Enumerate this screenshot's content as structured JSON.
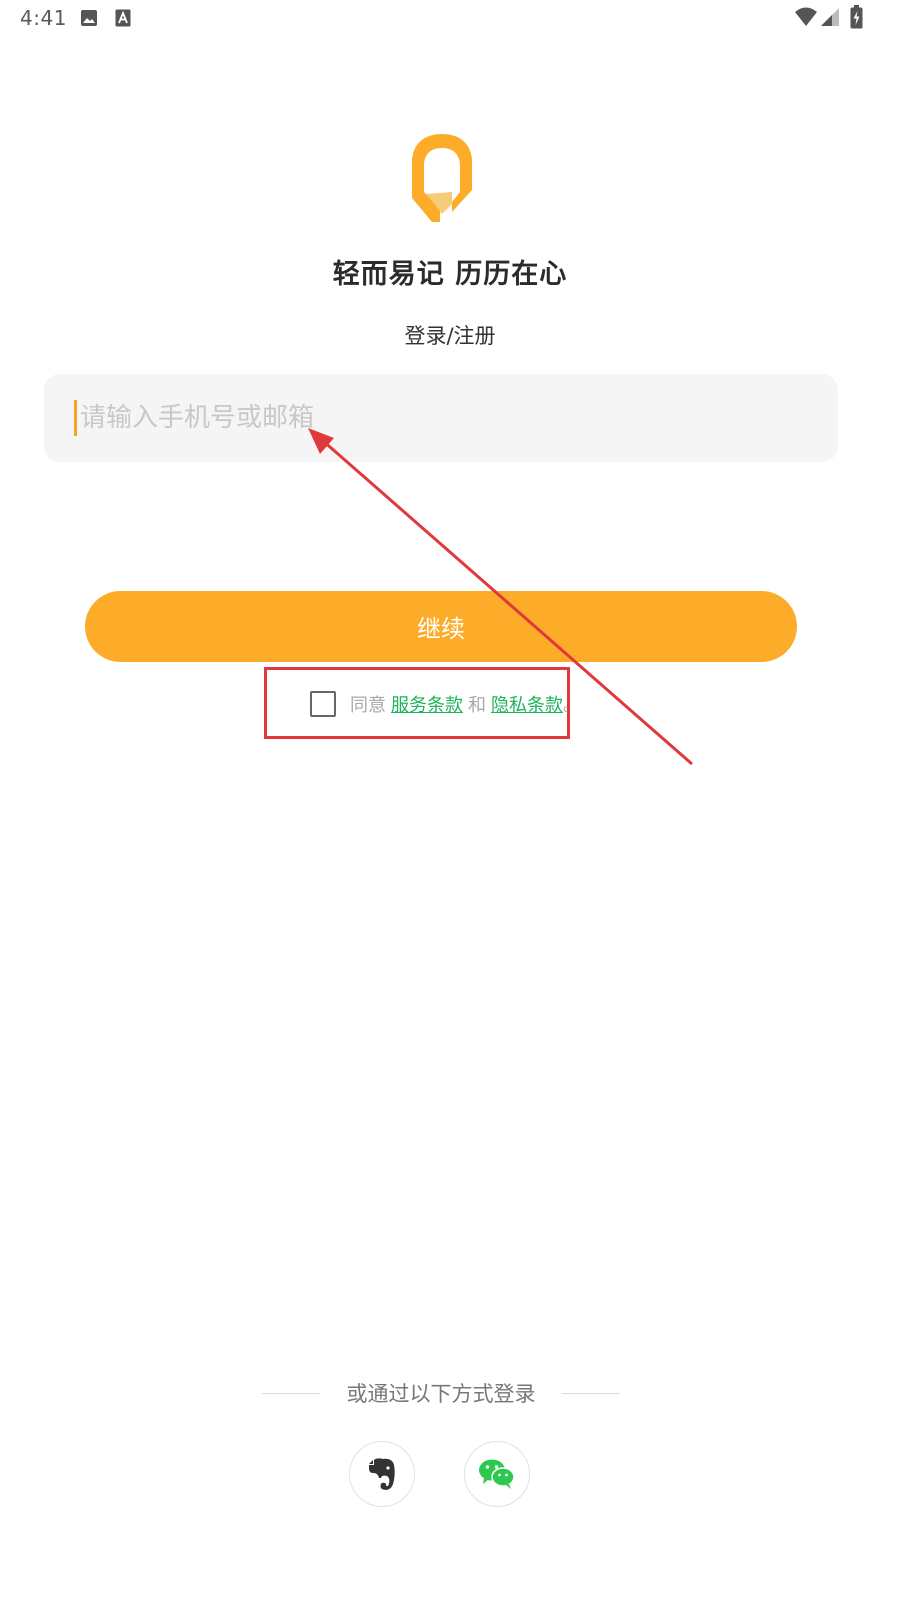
{
  "status_bar": {
    "time": "4:41"
  },
  "brand": {
    "slogan": "轻而易记 历历在心",
    "accent_color": "#fdac2a"
  },
  "login": {
    "title": "登录/注册",
    "input_placeholder": "请输入手机号或邮箱",
    "continue_label": "继续"
  },
  "agreement": {
    "prefix": "同意",
    "terms_link": "服务条款",
    "conjunction": "和",
    "privacy_link": "隐私条款",
    "suffix": "。",
    "checked": false,
    "link_color": "#1fb35a"
  },
  "alt_login": {
    "label": "或通过以下方式登录",
    "providers": [
      {
        "name": "Evernote",
        "icon": "evernote-icon"
      },
      {
        "name": "WeChat",
        "icon": "wechat-icon"
      }
    ]
  },
  "annotation": {
    "highlight_color": "#e0393b"
  }
}
